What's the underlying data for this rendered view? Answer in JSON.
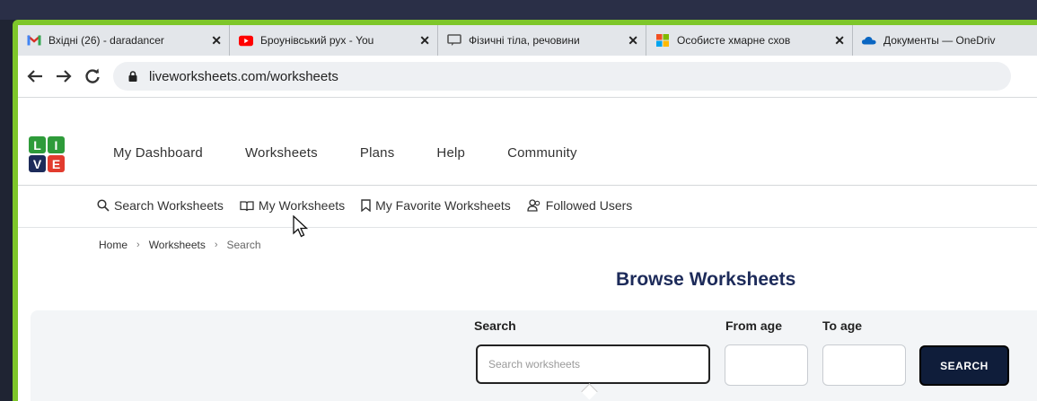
{
  "browser": {
    "tabs": [
      {
        "title": "Вхідні (26) - daradancer",
        "icon": "gmail-icon"
      },
      {
        "title": "Броунівський рух - You",
        "icon": "youtube-icon"
      },
      {
        "title": "Фізичні тіла, речовини",
        "icon": "chat-icon"
      },
      {
        "title": "Особисте хмарне схов",
        "icon": "microsoft-icon"
      },
      {
        "title": "Документы — OneDriv",
        "icon": "onedrive-icon"
      }
    ],
    "close_glyph": "✕",
    "url": "liveworksheets.com/worksheets"
  },
  "site": {
    "logo_letters": [
      "L",
      "I",
      "V",
      "E"
    ],
    "nav": [
      "My Dashboard",
      "Worksheets",
      "Plans",
      "Help",
      "Community"
    ],
    "subnav": [
      {
        "label": "Search Worksheets",
        "icon": "search-icon"
      },
      {
        "label": "My Worksheets",
        "icon": "book-icon"
      },
      {
        "label": "My Favorite Worksheets",
        "icon": "bookmark-icon"
      },
      {
        "label": "Followed Users",
        "icon": "users-icon"
      }
    ],
    "breadcrumb": [
      "Home",
      "Worksheets",
      "Search"
    ]
  },
  "main": {
    "title": "Browse Worksheets",
    "search_label": "Search",
    "search_placeholder": "Search worksheets",
    "from_age_label": "From age",
    "to_age_label": "To age",
    "search_button": "SEARCH"
  },
  "colors": {
    "frame_green": "#7ec62a",
    "title_navy": "#1d2b5a",
    "button_navy": "#0f1d3a",
    "logo_green": "#2e9b3a",
    "logo_red": "#e23b2e",
    "logo_navy": "#1d2b5a"
  }
}
